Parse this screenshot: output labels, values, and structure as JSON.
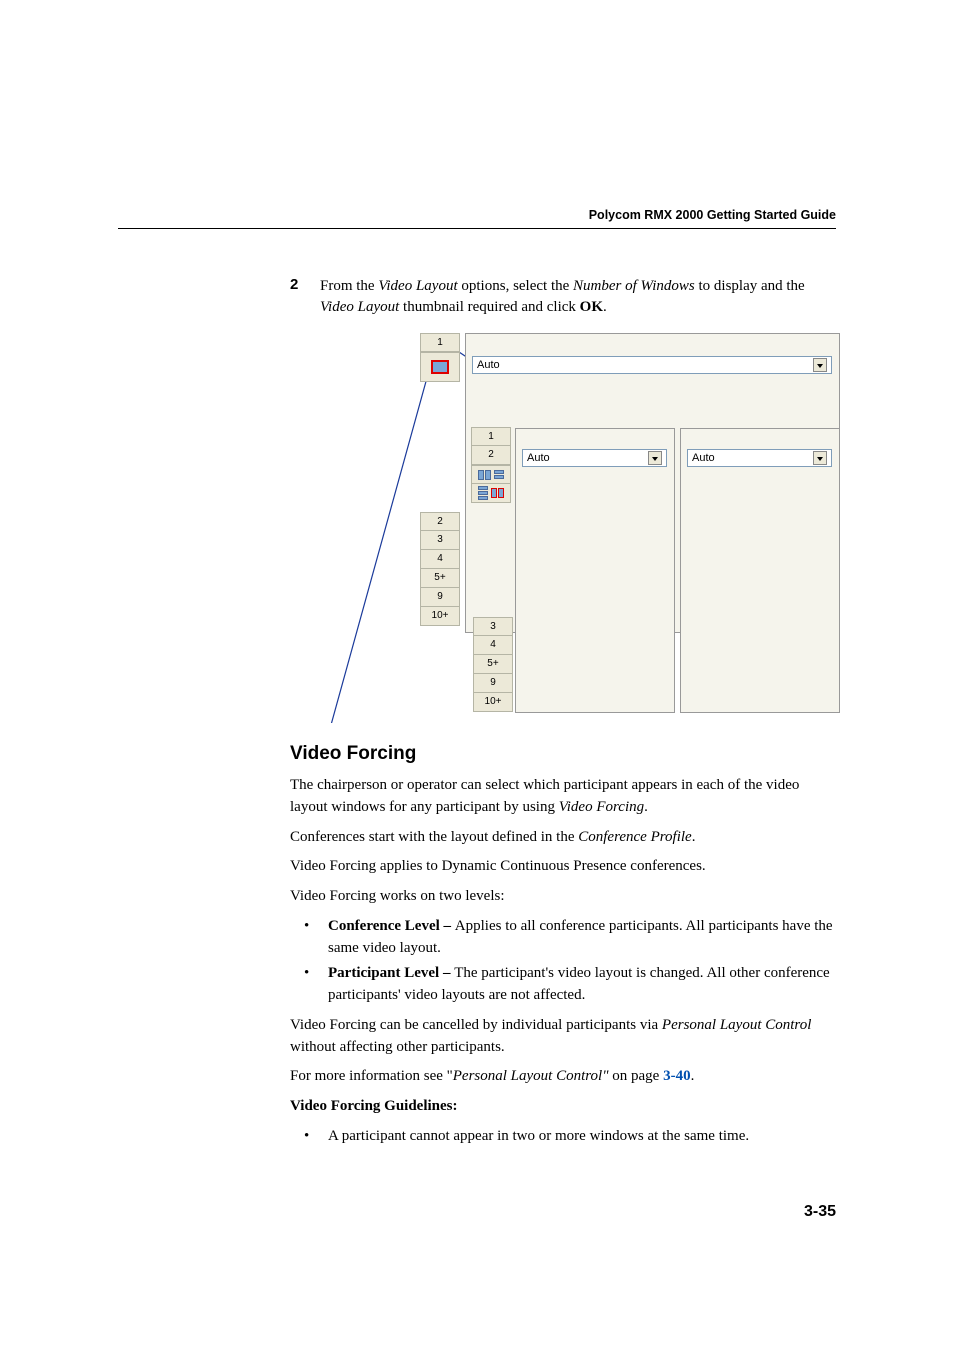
{
  "header": {
    "title": "Polycom RMX 2000 Getting Started Guide"
  },
  "step": {
    "number": "2",
    "prefix": "From the ",
    "videoLayout": "Video Layout",
    "mid1": " options, select the ",
    "numWindows": "Number of Windows",
    "mid2": " to display and the ",
    "videoLayout2": "Video Layout",
    "mid3": " thumbnail required and click ",
    "ok": "OK",
    "suffix": "."
  },
  "figure": {
    "col1": {
      "n1": "1",
      "n2": "2",
      "n3": "3",
      "n4": "4",
      "n5": "5+",
      "n9": "9",
      "n10": "10+"
    },
    "col2": {
      "n1": "1",
      "n2": "2"
    },
    "col3": {
      "n3": "3",
      "n4": "4",
      "n5": "5+",
      "n9": "9",
      "n10": "10+"
    },
    "auto": "Auto"
  },
  "section": {
    "heading": "Video Forcing",
    "p1a": "The chairperson or operator can select which participant appears in each of the video layout windows for any participant by using ",
    "p1b": "Video Forcing",
    "p1c": ".",
    "p2a": "Conferences start with the layout defined in the ",
    "p2b": "Conference Profile",
    "p2c": ".",
    "p3": "Video Forcing applies to Dynamic Continuous Presence conferences.",
    "p4": "Video Forcing works on two levels:",
    "b1label": "Conference Level – ",
    "b1text": "Applies to all conference participants. All participants have the same video layout.",
    "b2label": "Participant Level  – ",
    "b2text": "The participant's video layout is changed.  All other conference participants' video layouts are not affected.",
    "p5a": "Video Forcing can be cancelled by individual participants via ",
    "p5b": "Personal Layout Control",
    "p5c": " without affecting other participants.",
    "p6a": "For more information see \"",
    "p6b": "Personal Layout Control\"",
    "p6c": " on page ",
    "p6link": "3-40",
    "p6d": ".",
    "guidelines": "Video Forcing Guidelines:",
    "g1": "A participant cannot appear in two or more windows at the same time."
  },
  "pageNumber": "3-35"
}
